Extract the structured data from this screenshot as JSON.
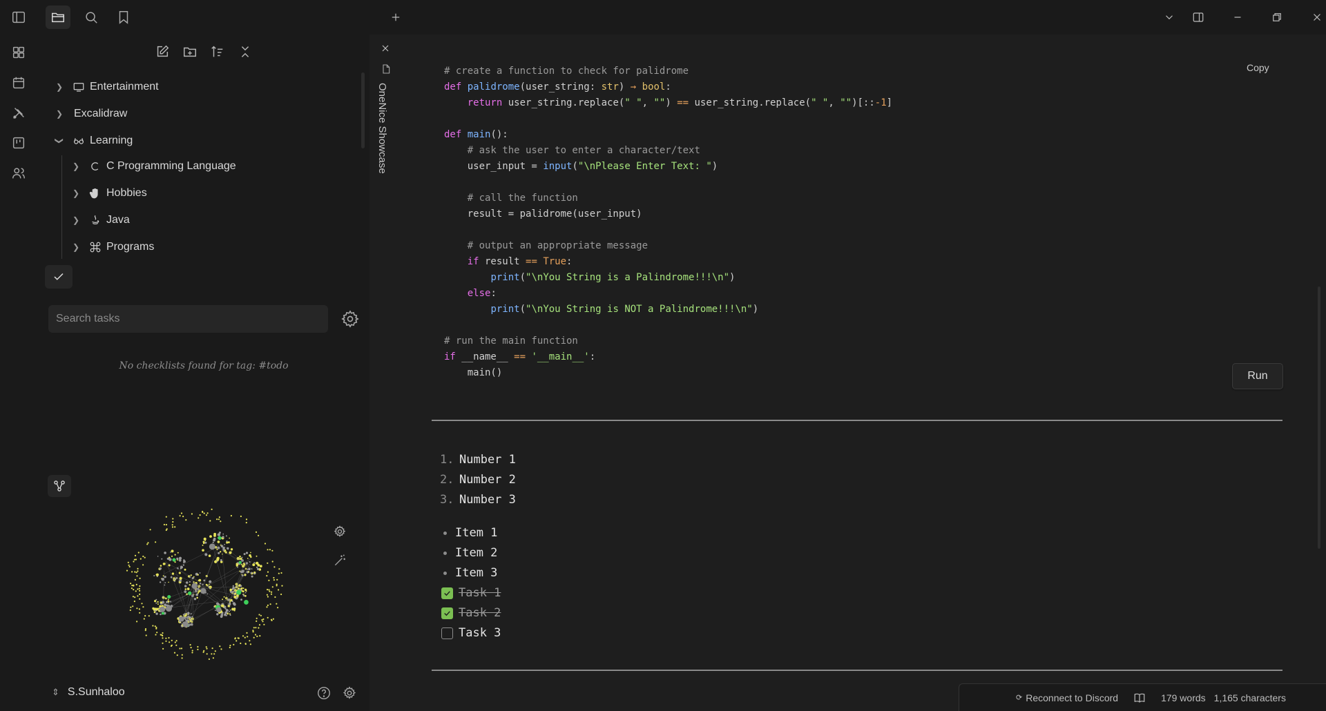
{
  "ribbon": {
    "icons": [
      "sidebar-toggle-icon",
      "canvas-icon",
      "calendar-icon",
      "excalidraw-icon",
      "kanban-icon",
      "people-icon"
    ]
  },
  "sidebar": {
    "tree": [
      {
        "label": "Entertainment",
        "icon": "monitor-icon",
        "expanded": false,
        "level": 0
      },
      {
        "label": "Excalidraw",
        "icon": "",
        "expanded": false,
        "level": 0
      },
      {
        "label": "Learning",
        "icon": "glasses-icon",
        "expanded": true,
        "level": 0
      },
      {
        "label": "C Programming Language",
        "icon": "c-language-icon",
        "expanded": false,
        "level": 1
      },
      {
        "label": "Hobbies",
        "icon": "hand-icon",
        "expanded": false,
        "level": 1
      },
      {
        "label": "Java",
        "icon": "java-icon",
        "expanded": false,
        "level": 1
      },
      {
        "label": "Programs",
        "icon": "command-icon",
        "expanded": false,
        "level": 1
      }
    ],
    "tasks": {
      "search_placeholder": "Search tasks",
      "empty_message": "No checklists found for tag: #todo"
    },
    "vault": {
      "name": "S.Sunhaloo"
    }
  },
  "main": {
    "stack_title": "OneNice Showcase",
    "copy_label": "Copy",
    "run_label": "Run",
    "ordered_list": [
      {
        "num": "1.",
        "text": "Number 1"
      },
      {
        "num": "2.",
        "text": "Number 2"
      },
      {
        "num": "3.",
        "text": "Number 3"
      }
    ],
    "bullet_list": [
      "Item 1",
      "Item 2",
      "Item 3"
    ],
    "tasks": [
      {
        "text": "Task 1",
        "done": true
      },
      {
        "text": "Task 2",
        "done": true
      },
      {
        "text": "Task 3",
        "done": false
      }
    ]
  },
  "status": {
    "discord": "Reconnect to Discord",
    "words": "179 words",
    "characters": "1,165 characters"
  },
  "colors": {
    "accent_check": "#7bbf52",
    "graph_yellow": "#e6e35a",
    "graph_green": "#3ecf5a",
    "graph_gray": "#9a9a9a"
  }
}
